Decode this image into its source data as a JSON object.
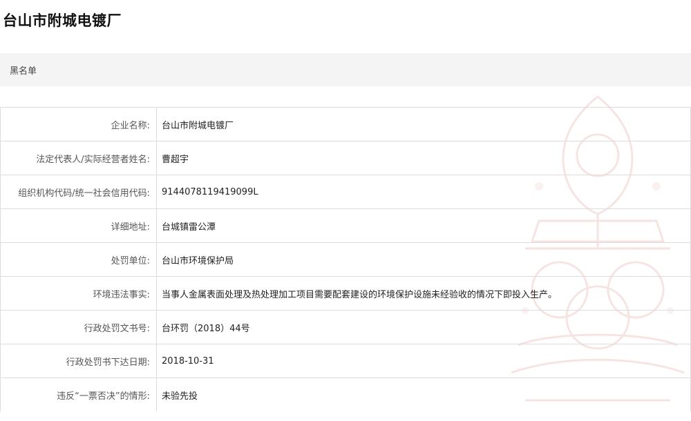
{
  "page": {
    "title": "台山市附城电镀厂",
    "section_label": "黑名单"
  },
  "fields": [
    {
      "label": "企业名称:",
      "value": "台山市附城电镀厂"
    },
    {
      "label": "法定代表人/实际经营者姓名:",
      "value": "曹超宇"
    },
    {
      "label": "组织机构代码/统一社会信用代码:",
      "value": "9144078119419099L"
    },
    {
      "label": "详细地址:",
      "value": "台城镇雷公潭"
    },
    {
      "label": "处罚单位:",
      "value": "台山市环境保护局"
    },
    {
      "label": "环境违法事实:",
      "value": "当事人金属表面处理及热处理加工项目需要配套建设的环境保护设施未经验收的情况下即投入生产。"
    },
    {
      "label": "行政处罚文书号:",
      "value": "台环罚（2018）44号"
    },
    {
      "label": "行政处罚书下达日期:",
      "value": "2018-10-31"
    },
    {
      "label": "违反“一票否决”的情形:",
      "value": "未验先投"
    }
  ]
}
